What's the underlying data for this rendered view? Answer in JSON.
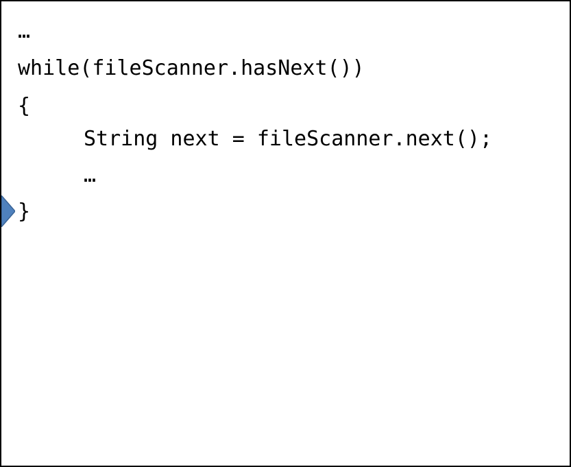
{
  "code": {
    "lines": [
      "…",
      "while(fileScanner.hasNext())",
      "{",
      "String next = fileScanner.next();",
      "…",
      "}"
    ]
  },
  "pointer": {
    "icon": "arrow-pointer-icon",
    "color": "#4f81bd"
  }
}
